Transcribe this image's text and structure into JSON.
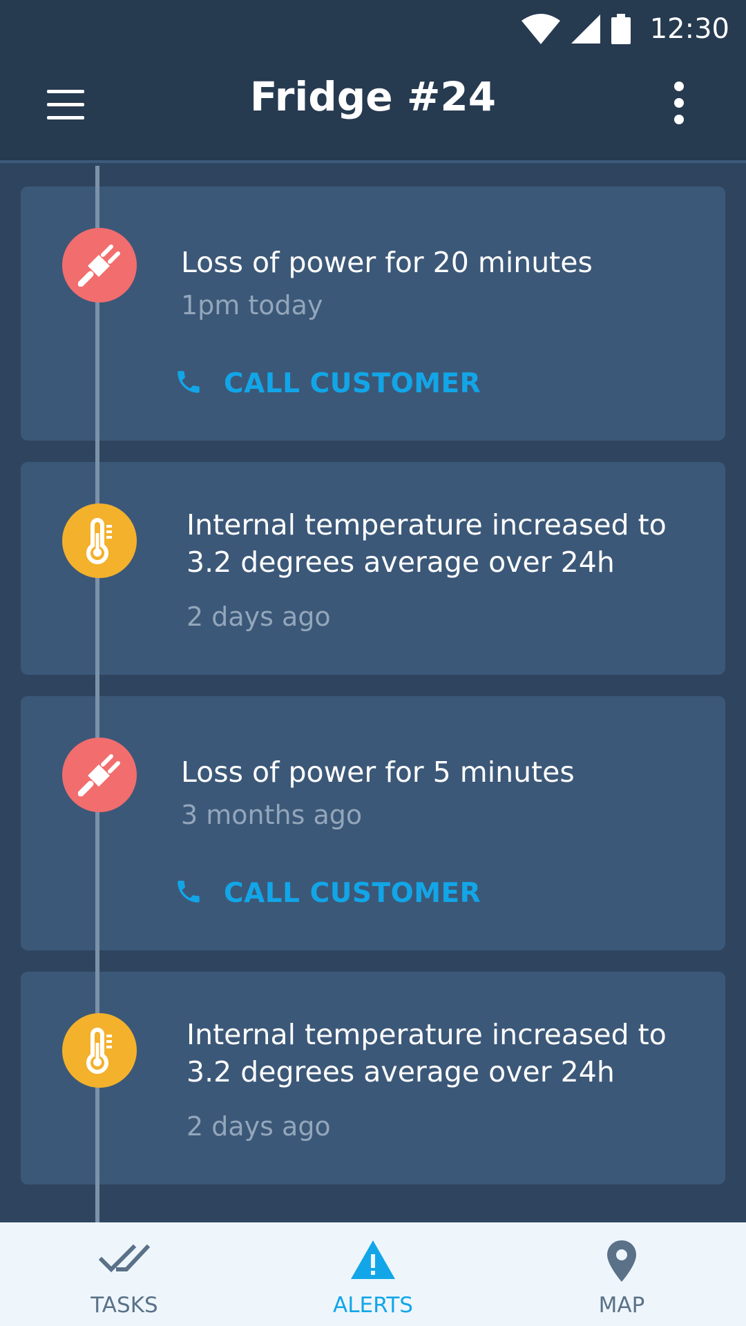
{
  "status_bar": {
    "time": "12:30",
    "icons": [
      "wifi-icon",
      "signal-icon",
      "battery-icon"
    ]
  },
  "app_bar": {
    "title": "Fridge #24",
    "menu_icon": "hamburger-menu-icon",
    "more_icon": "more-vert-icon"
  },
  "alerts": [
    {
      "icon": "plug-icon",
      "color": "#f26d6d",
      "title_lines": [
        "Loss of power for 20 minutes"
      ],
      "time": "1pm today",
      "action": "CALL CUSTOMER"
    },
    {
      "icon": "thermometer-icon",
      "color": "#f3b12c",
      "title_lines": [
        "Internal temperature increased to",
        "3.2 degrees average over 24h"
      ],
      "time": "2 days ago"
    },
    {
      "icon": "plug-icon",
      "color": "#f26d6d",
      "title_lines": [
        "Loss of power for 5 minutes"
      ],
      "time": "3 months ago",
      "action": "CALL CUSTOMER"
    },
    {
      "icon": "thermometer-icon",
      "color": "#f3b12c",
      "title_lines": [
        "Internal temperature increased to",
        "3.2 degrees average over 24h"
      ],
      "time": "2 days ago"
    }
  ],
  "bottom_nav": {
    "items": [
      {
        "label": "TASKS",
        "icon": "double-check-icon",
        "active": false
      },
      {
        "label": "ALERTS",
        "icon": "warning-icon",
        "active": true
      },
      {
        "label": "MAP",
        "icon": "map-pin-icon",
        "active": false
      }
    ],
    "active_color": "#12a6e8",
    "inactive_color": "#5a7188"
  }
}
